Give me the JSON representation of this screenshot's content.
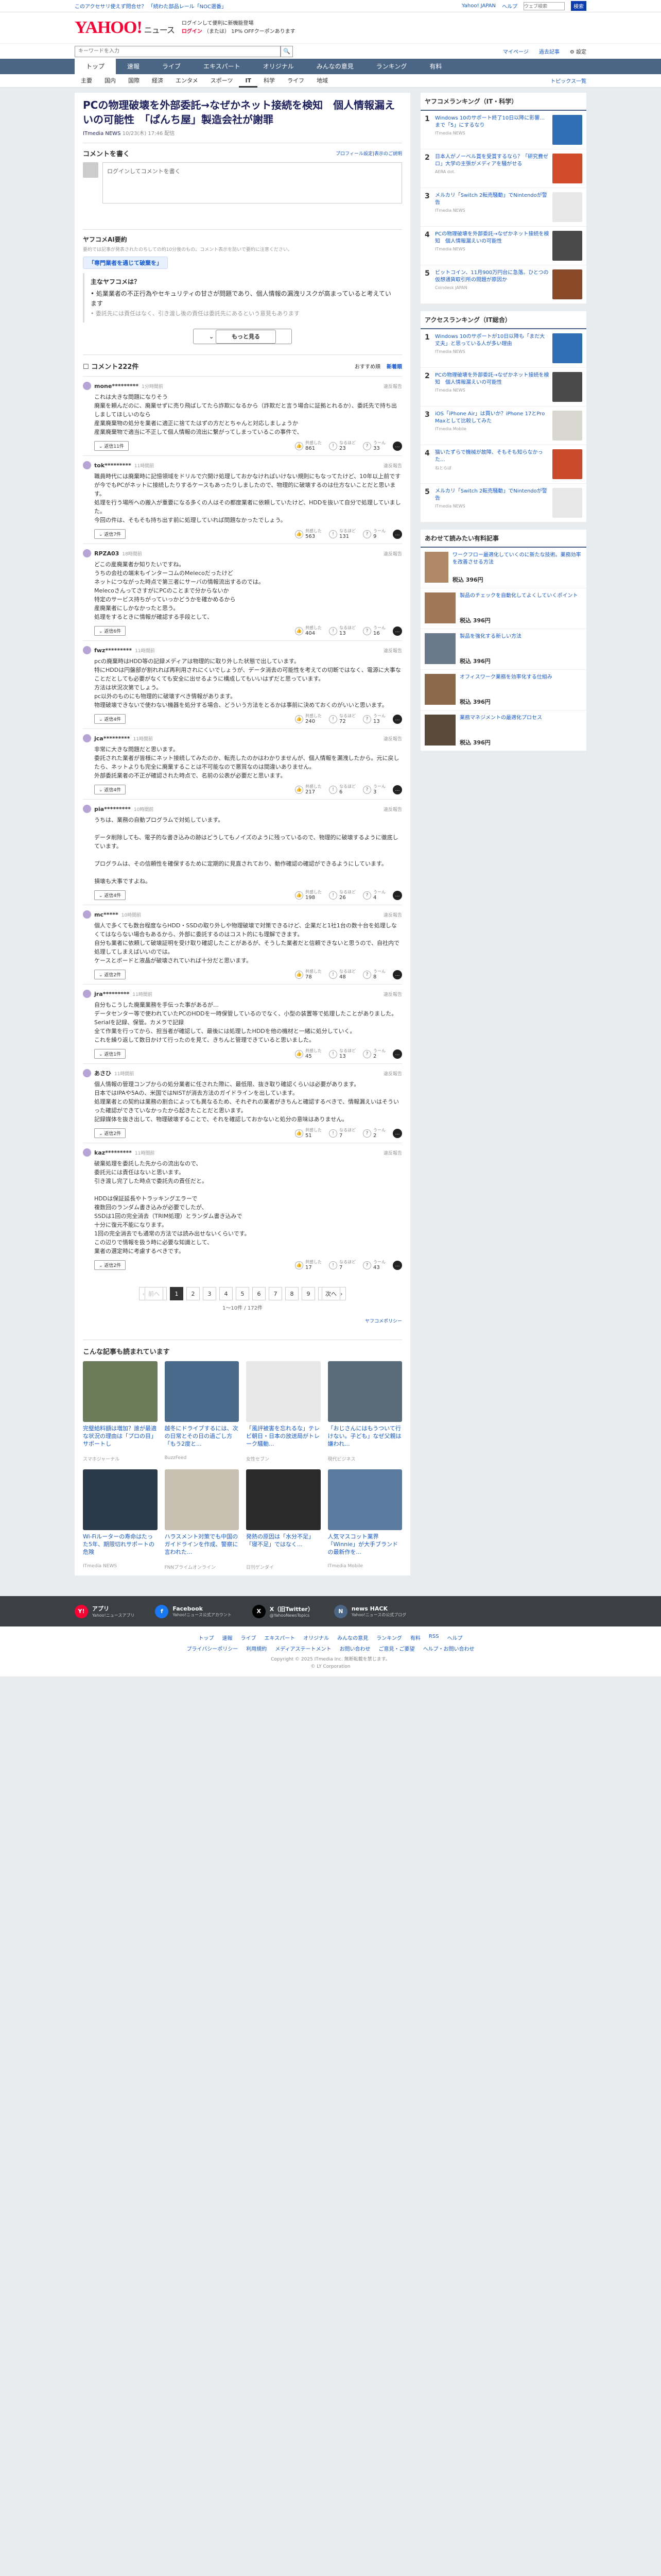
{
  "topbar": {
    "left_link": "このアクセサリ使えず問合せ？ 「続わた部品レール「NOC選番」",
    "right_links": [
      "Yahoo! JAPAN",
      "ヘルプ"
    ],
    "search_placeholder": "ウェブ検索",
    "search_button": "検索"
  },
  "header": {
    "logo": "YAHOO!",
    "logo_sub": "ニュース",
    "promo_line1": "ログインして便利に新機能登場",
    "promo_login": "ログイン",
    "promo_line2": "（または）",
    "promo_line3": "1P% OFFクーポンあります"
  },
  "subbar": {
    "search_placeholder": "キーワードを入力",
    "links": [
      "マイページ",
      "過去記事",
      "設定"
    ]
  },
  "nav": {
    "items": [
      "トップ",
      "速報",
      "ライブ",
      "エキスパート",
      "オリジナル",
      "みんなの意見",
      "ランキング",
      "有料"
    ],
    "active": 0
  },
  "subnav": {
    "items": [
      "主要",
      "国内",
      "国際",
      "経済",
      "エンタメ",
      "スポーツ",
      "IT",
      "科学",
      "ライフ",
      "地域"
    ],
    "active": 6,
    "more": "トピックス一覧"
  },
  "article": {
    "title": "PCの物理破壊を外部委託→なぜかネット接続を検知　個人情報漏えいの可能性　「ぱんち屋」製造会社が謝罪",
    "source": "ITmedia NEWS",
    "date": "10/23(木) 17:46 配信"
  },
  "comment_write": {
    "heading": "コメントを書く",
    "policy": "プロフィール設定|表示のご説明",
    "placeholder": "ログインしてコメントを書く"
  },
  "summary": {
    "heading": "ヤフコメAI要約",
    "note": "要約では記事が発表されたのちしての約10分後のもの。コメント表示を防いで要約に注意ください。",
    "chip": "「専門業者を通じて破棄を」",
    "box_title": "主なヤフコメは？",
    "line1": "• 処業業者の不正行為やセキュリティの甘さが問題であり、個人情報の漏洩リスクが高まっていると考えています",
    "line2": "• 委託先には責任はなく、引き渡し後の責任は委託先にあるという意見もあります",
    "more": "もっと見る"
  },
  "comments_header": {
    "title": "コメント222件",
    "sort": [
      "おすすめ順",
      "新着順"
    ],
    "active_sort": 1
  },
  "comments": [
    {
      "user": "mone*********",
      "time": "1分時間前",
      "flag": "違反報告",
      "body": "これは大きな問題になりそう\n廃棄を頼んだのに、廃棄せずに売り飛ばしてたら詐欺になるから（詐欺だと言う場合に証拠とれるか）、委託先で持ち出しましてほしいのなら\n産業廃棄物の処分を業者に適正に捨てたはずの方だとちゃんと対応しましょうか\n産業廃棄物で適当に不正して個人情報の流出に繋がってしまっているこの事件で、",
      "reply": "返信11件",
      "r1": "861",
      "r2": "23",
      "r3": "33"
    },
    {
      "user": "tok*********",
      "time": "11時間前",
      "flag": "違反報告",
      "body": "職員時代には廃棄時に記憶領域をドリルで穴開け処理しておかなければいけない規則にもなってたけど、10年以上前ですが今でもPCがネットに接続したりするケースもあったりしましたので、物理的に破壊するのは仕方ないことだと思います。\n処理を行う場所への搬入が重要になる多くの人はその都度業者に依頼していたけど、HDDを抜いて自分で処理していました。\n今回の件は、そもそも持ち出す前に処理していれば問題なかったでしょう。",
      "reply": "返信7件",
      "r1": "563",
      "r2": "131",
      "r3": "9"
    },
    {
      "user": "RPZA03",
      "time": "18時間前",
      "flag": "違反報告",
      "body": "どこの産廃業者か知りたいですね。\nうちの会社の端末もインターコムのMelecoだったけど\nネットにつながった時点で第三者にサーバの情報流出するのでは。\nMelecoさんってさすがにPCのことまで分からないか\n特定のサービス持ちがっていっかどうかを確かめるから\n産廃業者にしかなかったと思う。\n処理をするときに情報が確認する手段として、",
      "reply": "返信6件",
      "r1": "404",
      "r2": "13",
      "r3": "16"
    },
    {
      "user": "fwz*********",
      "time": "11時間前",
      "flag": "違反報告",
      "body": "pcの廃棄時はHDD等の記録メディアは物理的に取り外した状態で出しています。\n特にHDDは円盤部が割れれば再利用されにくいでしょうが、データ消去の可能性を考えての切断ではなく、電源に大事なことだとしても必要がなくても安全に出せるように構成してもいいはずだと思っています。\n方法は状況次第でしょう。\npc以外のものにも物理的に破壊すべき情報があります。\n物理破壊できないで使わない機器を処分する場合、どういう方法をとるかは事前に決めておくのがいいと思います。",
      "reply": "返信4件",
      "r1": "240",
      "r2": "72",
      "r3": "13"
    },
    {
      "user": "jca*********",
      "time": "11時間前",
      "flag": "違反報告",
      "body": "非常に大きな問題だと思います。\n委託された業者が皆様にネット接続してみたのか、転売したのかはわかりませんが、個人情報を漏洩したから。元に戻したら、ネットよりも完全に廃棄することは不可能なので悪質なのは間違いありません。\n外部委託業者の不正が確認された時点で、名前の公表が必要だと思います。",
      "reply": "返信4件",
      "r1": "217",
      "r2": "6",
      "r3": "3"
    },
    {
      "user": "pia*********",
      "time": "10時間前",
      "flag": "違反報告",
      "body": "うちは、業務の自動プログラムで対処しています。\n\nデータ削除しても、電子的な書き込みの跡はどうしてもノイズのように残っているので、物理的に破壊するように徹底しています。\n\nプログラムは、その信頼性を確保するために定期的に見直されており、動作確認の確認ができるようにしています。\n\n損壊も大事ですよね。",
      "reply": "返信4件",
      "r1": "198",
      "r2": "26",
      "r3": "4"
    },
    {
      "user": "mc*****",
      "time": "10時間前",
      "flag": "違反報告",
      "body": "個人で多くても数台程度ならHDD・SSDの取り外しや物理破壊で対策できるけど、企業だと1社1台の数十台を処理しなくてはならない場合もあるから、外部に委託するのはコスト的にも理解できます。\n自分も業者に依頼して破壊証明を受け取り確認したことがあるが、そうした業者だと信頼できないと思うので、自社内で処理してしまえばいいのでは。\nケースとボードと液晶が破壊されていれば十分だと思います。",
      "reply": "返信2件",
      "r1": "78",
      "r2": "48",
      "r3": "8"
    },
    {
      "user": "jra*********",
      "time": "11時間前",
      "flag": "違反報告",
      "body": "自分もこうした廃棄業務を手伝った事があるが…\nデータセンター等で使われていたPCのHDDを一時保管しているのでなく、小型の装置等で処理したことがありました。\nSerialを記録、保管。カメラで記録\n全て作業を行ってから、担当者が確認して、最後には処理したHDDを他の機材と一緒に処分していく。\nこれを繰り返して数日かけて行ったのを見て、きちんと管理できていると思いました。",
      "reply": "返信1件",
      "r1": "45",
      "r2": "13",
      "r3": "2"
    },
    {
      "user": "あさひ",
      "time": "11時間前",
      "flag": "違反報告",
      "body": "個人情報の管理コンプからの処分業者に任された際に、最低限、抜き取り確認くらいは必要があります。\n日本ではIPAや5Aの、米国ではNISTが消去方法のガイドラインを出しています。\n処理業者との契約は業務の割合によっても異なるため、それぞれの業者がきちんと確認するべきで、情報漏えいはそういった確認ができていなかったから起きたことだと思います。\n記録媒体を抜き出して、物理破壊することで、それを確認しておかないと処分の意味はありません。",
      "reply": "返信2件",
      "r1": "51",
      "r2": "7",
      "r3": "2"
    },
    {
      "user": "kaz*********",
      "time": "11時間前",
      "flag": "違反報告",
      "body": "破棄処理を委託した先からの流出なので、\n委託元には責任はないと思います。\n引き渡し完了した時点で委託先の責任だと。\n\nHDDは保証延長やトラッキングエラーで\n複数回のランダム書き込みが必要でしたが、\nSSDは1回の完全消去（TRIM処理）とランダム書き込みで\n十分に復元不能になります。\n1回の完全消去でも通常の方法では読み出せないくらいです。\nこの辺りで情報を扱う時に必要な知識として、\n業者の選定時に考慮するべきです。",
      "reply": "返信2件",
      "r1": "17",
      "r2": "7",
      "r3": "43"
    }
  ],
  "pager": {
    "prev": "前へ",
    "pages": [
      "1",
      "2",
      "3",
      "4",
      "5",
      "6",
      "7",
      "8",
      "9"
    ],
    "next": "次へ",
    "range": "1〜10件 / 172件",
    "policy": "ヤフコメポリシー"
  },
  "recommend": {
    "heading": "こんな記事も読まれています",
    "items": [
      {
        "title": "完璧給料額は増加？誰が最適な状況の理由は「プロの目」サポートし",
        "src": "スマホジャーナル",
        "color": "#6b7b5a"
      },
      {
        "title": "越冬にドライブするには、次の日常とその日の過ごし方「もう2度と...",
        "src": "BuzzFeed",
        "color": "#4a6a8c"
      },
      {
        "title": "「風評被害を忘れるな」テレビ朝日・日本の放送局がトレーク騒動...",
        "src": "女性セブン",
        "color": "#e8e8e8"
      },
      {
        "title": "「おじさんにはもうついて行けない。子ども」なぜ父親は嫌われ...",
        "src": "現代ビジネス",
        "color": "#5a6b7a"
      },
      {
        "title": "Wi-Fiルーターの寿命はたった5年、期限切れサポートの危険",
        "src": "ITmedia NEWS",
        "color": "#2a3a4a"
      },
      {
        "title": "ハラスメント対策でも中国のガイドラインを作成、警察に言われた...",
        "src": "FNNプライムオンライン",
        "color": "#c8c0b0"
      },
      {
        "title": "発熱の原因は「水分不足」「寝不足」ではなく...",
        "src": "日刊ゲンダイ",
        "color": "#2a2a2a"
      },
      {
        "title": "人気マスコット業界「Winnie」が大手ブランドの最新作を...",
        "src": "ITmedia Mobile",
        "color": "#5a7aa0"
      }
    ]
  },
  "side_ranking1": {
    "heading": "ヤフコメランキング（IT・科学）",
    "items": [
      {
        "title": "Windows 10のサポート終了10日以降に影響...まで「5」にするなり",
        "src": "ITmedia NEWS",
        "color": "#2e6eb5"
      },
      {
        "title": "日本人がノーベル賞を受賞するなら？「研究費ゼロ」大学の主張がメディアを騒がせる",
        "src": "AERA dot.",
        "color": "#d14a2a"
      },
      {
        "title": "メルカリ「Switch 2転売騒動」でNintendoが警告",
        "src": "ITmedia NEWS",
        "color": "#e8e8e8"
      },
      {
        "title": "PCの物理破壊を外部委託→なぜかネット接続を検知　個人情報漏えいの可能性",
        "src": "ITmedia NEWS",
        "color": "#4a4a4a"
      },
      {
        "title": "ビットコイン、11月900万円台に急落。ひとつの仮想通貨取引所の問題が原因か",
        "src": "Coindesk JAPAN",
        "color": "#8a4a2a"
      }
    ]
  },
  "side_ranking2": {
    "heading": "アクセスランキング（IT総合）",
    "items": [
      {
        "title": "Windows 10のサポートが10日以降も「まだ大丈夫」と思っている人が多い理由",
        "src": "ITmedia NEWS",
        "color": "#2e6eb5"
      },
      {
        "title": "PCの物理破壊を外部委託→なぜかネット接続を検知　個人情報漏えいの可能性",
        "src": "ITmedia NEWS",
        "color": "#4a4a4a"
      },
      {
        "title": "iOS「iPhone Air」は買いか？iPhone 17とPro Maxとして比較してみた",
        "src": "ITmedia Mobile",
        "color": "#d8d8d0"
      },
      {
        "title": "猫いたずらで機械が故障、そもそも知らなかった...",
        "src": "ねとらぼ",
        "color": "#c84a2a"
      },
      {
        "title": "メルカリ「Switch 2転売騒動」でNintendoが警告",
        "src": "ITmedia NEWS",
        "color": "#e8e8e8"
      }
    ]
  },
  "side_products": {
    "heading": "あわせて読みたい有料記事",
    "items": [
      {
        "title": "ワークフロー最適化していくのに新たな技術。業務効率を改善させる方法",
        "price": "税込 396円",
        "color": "#b08968"
      },
      {
        "title": "製品のチェックを自動化してよくしていくポイント",
        "price": "税込 396円",
        "color": "#a07858"
      },
      {
        "title": "製品を強化する新しい方法",
        "price": "税込 396円",
        "color": "#6a7a8a"
      },
      {
        "title": "オフィスワーク業務を効率化する仕組み",
        "price": "税込 396円",
        "color": "#8a6a4a"
      },
      {
        "title": "業務マネジメントの最適化プロセス",
        "price": "税込 396円",
        "color": "#5a4a3a"
      }
    ]
  },
  "footer_share": [
    {
      "name": "アプリ",
      "sub": "Yahoo!ニュースアプリ",
      "icon": "Y!",
      "color": "#ff0033"
    },
    {
      "name": "Facebook",
      "sub": "Yahoo!ニュース公式アカウント",
      "icon": "f",
      "color": "#1877f2"
    },
    {
      "name": "X（旧Twitter）",
      "sub": "@YahooNewsTopics",
      "icon": "X",
      "color": "#000000"
    },
    {
      "name": "news HACK",
      "sub": "Yahoo!ニュースの公式ブログ",
      "icon": "N",
      "color": "#4b6585"
    }
  ],
  "footer": {
    "links": [
      "トップ",
      "速報",
      "ライブ",
      "エキスパート",
      "オリジナル",
      "みんなの意見",
      "ランキング",
      "有料",
      "RSS",
      "ヘルプ"
    ],
    "links2": [
      "プライバシーポリシー",
      "利用規約",
      "メディアステートメント",
      "お問い合わせ",
      "ご意見・ご要望",
      "ヘルプ・お問い合わせ"
    ],
    "copyright": "Copyright © 2025 ITmedia Inc. 無断転載を禁じます。",
    "copyright2": "© LY Corporation"
  }
}
